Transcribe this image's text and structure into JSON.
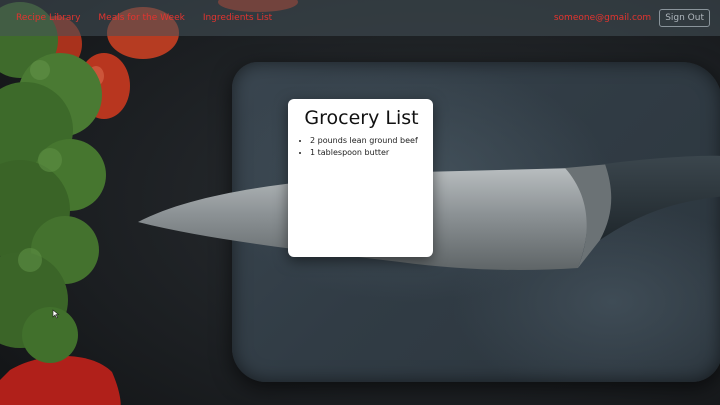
{
  "nav": {
    "links": [
      {
        "label": "Recipe Library"
      },
      {
        "label": "Meals for the Week"
      },
      {
        "label": "Ingredients List"
      }
    ],
    "user_email": "someone@gmail.com",
    "signout_label": "Sign Out"
  },
  "grocery": {
    "title": "Grocery List",
    "items": [
      "2 pounds lean ground beef",
      "1 tablespoon butter"
    ]
  },
  "colors": {
    "nav_link": "#e3342f",
    "card_background": "#ffffff",
    "navbar_background": "#46525a"
  },
  "icons": {
    "background": "kitchen-scene-image",
    "cursor": "mouse-pointer-icon"
  }
}
